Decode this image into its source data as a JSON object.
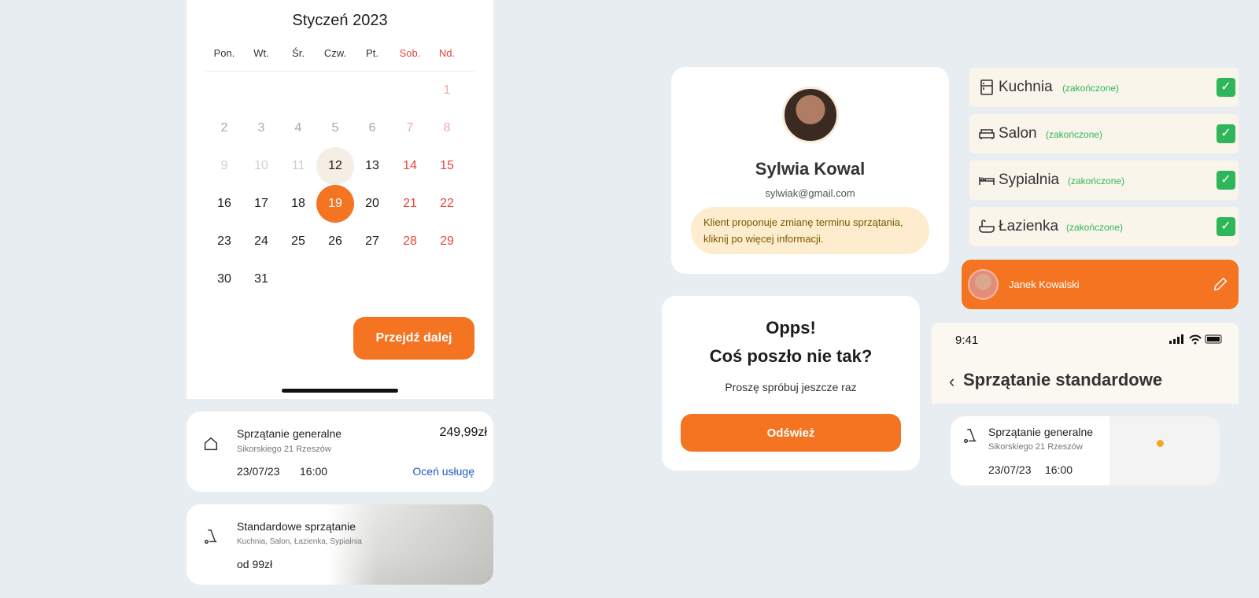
{
  "calendar": {
    "title": "Styczeń 2023",
    "weekdays": [
      "Pon.",
      "Wt.",
      "Śr.",
      "Czw.",
      "Pt.",
      "Sob.",
      "Nd."
    ],
    "days": [
      "1",
      "2",
      "3",
      "4",
      "5",
      "6",
      "7",
      "8",
      "9",
      "10",
      "11",
      "12",
      "13",
      "14",
      "15",
      "16",
      "17",
      "18",
      "19",
      "20",
      "21",
      "22",
      "23",
      "24",
      "25",
      "26",
      "27",
      "28",
      "29",
      "30",
      "31"
    ],
    "today": "12",
    "selected": "19",
    "next_label": "Przejdź dalej"
  },
  "service_general": {
    "title": "Sprzątanie generalne",
    "address": "Sikorskiego 21 Rzeszów",
    "date": "23/07/23",
    "time": "16:00",
    "price": "249,99zł",
    "rate_label": "Oceń usługę"
  },
  "service_standard": {
    "title": "Standardowe sprzątanie",
    "rooms": "Kuchnia, Salon, Łazienka, Sypialnia",
    "price": "od 99zł"
  },
  "profile": {
    "name": "Sylwia Kowal",
    "email": "sylwiak@gmail.com",
    "notice": "Klient proponuje zmianę terminu sprzątania, kliknij po więcej informacji."
  },
  "error": {
    "title_line1": "Opps!",
    "title_line2": "Coś poszło nie tak?",
    "message": "Proszę spróbuj jeszcze raz",
    "button": "Odśwież"
  },
  "rooms": [
    {
      "name": "Kuchnia",
      "status": "(zakończone)",
      "icon": "fridge-icon"
    },
    {
      "name": "Salon",
      "status": "(zakończone)",
      "icon": "sofa-icon"
    },
    {
      "name": "Sypialnia",
      "status": "(zakończone)",
      "icon": "bed-icon"
    },
    {
      "name": "Łazienka",
      "status": "(zakończone)",
      "icon": "bathtub-icon"
    }
  ],
  "worker": {
    "name": "Janek Kowalski"
  },
  "phone": {
    "time": "9:41",
    "title": "Sprzątanie standardowe"
  },
  "service_detail": {
    "title": "Sprzątanie generalne",
    "address": "Sikorskiego 21 Rzeszów",
    "date": "23/07/23",
    "time": "16:00"
  },
  "colors": {
    "accent": "#f47421",
    "success": "#2fb65b",
    "weekend": "#e4463d",
    "link": "#1f58c8"
  }
}
